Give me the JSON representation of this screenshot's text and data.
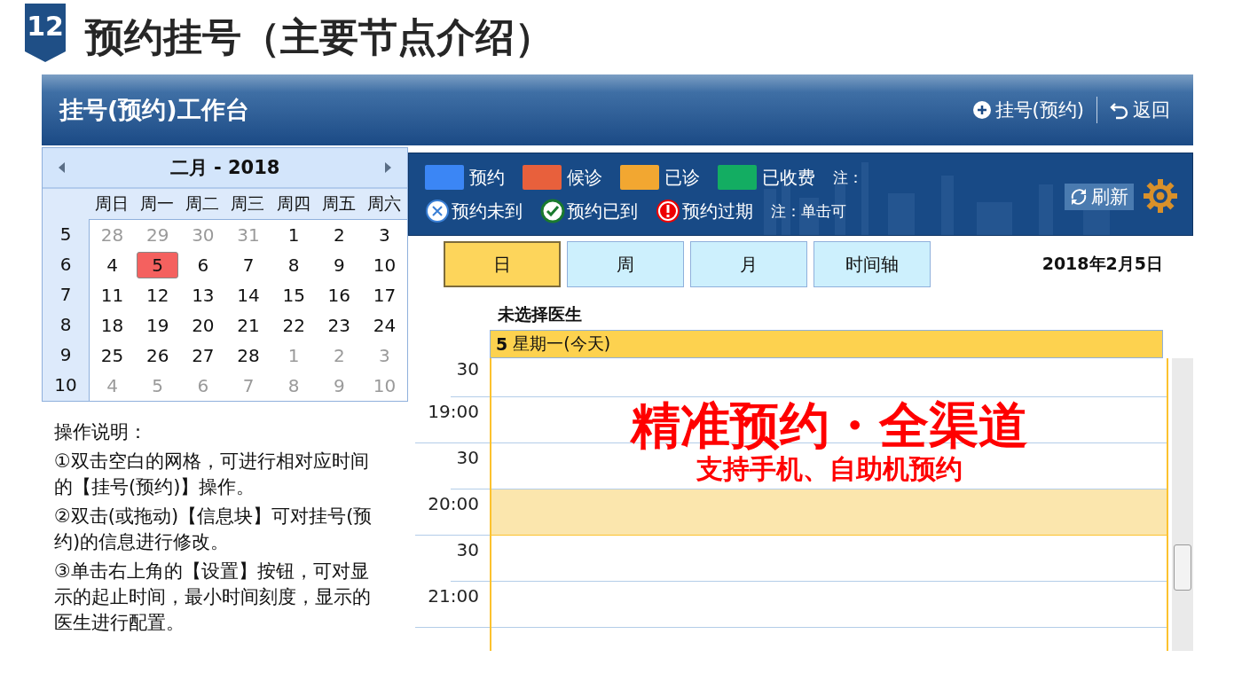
{
  "slide": {
    "number": "12",
    "title": "预约挂号（主要节点介绍）"
  },
  "window": {
    "title": "挂号(预约)工作台",
    "actions": [
      {
        "kind": "add",
        "label": "挂号(预约)"
      },
      {
        "kind": "back",
        "label": "返回"
      }
    ]
  },
  "calendar": {
    "month_title": "二月 - 2018",
    "weekdays": [
      "周日",
      "周一",
      "周二",
      "周三",
      "周四",
      "周五",
      "周六"
    ],
    "weeks": [
      {
        "week": "5",
        "days": [
          {
            "text": "28",
            "other_month": true,
            "selected": false
          },
          {
            "text": "29",
            "other_month": true,
            "selected": false
          },
          {
            "text": "30",
            "other_month": true,
            "selected": false
          },
          {
            "text": "31",
            "other_month": true,
            "selected": false
          },
          {
            "text": "1",
            "other_month": false,
            "selected": false
          },
          {
            "text": "2",
            "other_month": false,
            "selected": false
          },
          {
            "text": "3",
            "other_month": false,
            "selected": false
          }
        ]
      },
      {
        "week": "6",
        "days": [
          {
            "text": "4",
            "other_month": false,
            "selected": false
          },
          {
            "text": "5",
            "other_month": false,
            "selected": true
          },
          {
            "text": "6",
            "other_month": false,
            "selected": false
          },
          {
            "text": "7",
            "other_month": false,
            "selected": false
          },
          {
            "text": "8",
            "other_month": false,
            "selected": false
          },
          {
            "text": "9",
            "other_month": false,
            "selected": false
          },
          {
            "text": "10",
            "other_month": false,
            "selected": false
          }
        ]
      },
      {
        "week": "7",
        "days": [
          {
            "text": "11",
            "other_month": false,
            "selected": false
          },
          {
            "text": "12",
            "other_month": false,
            "selected": false
          },
          {
            "text": "13",
            "other_month": false,
            "selected": false
          },
          {
            "text": "14",
            "other_month": false,
            "selected": false
          },
          {
            "text": "15",
            "other_month": false,
            "selected": false
          },
          {
            "text": "16",
            "other_month": false,
            "selected": false
          },
          {
            "text": "17",
            "other_month": false,
            "selected": false
          }
        ]
      },
      {
        "week": "8",
        "days": [
          {
            "text": "18",
            "other_month": false,
            "selected": false
          },
          {
            "text": "19",
            "other_month": false,
            "selected": false
          },
          {
            "text": "20",
            "other_month": false,
            "selected": false
          },
          {
            "text": "21",
            "other_month": false,
            "selected": false
          },
          {
            "text": "22",
            "other_month": false,
            "selected": false
          },
          {
            "text": "23",
            "other_month": false,
            "selected": false
          },
          {
            "text": "24",
            "other_month": false,
            "selected": false
          }
        ]
      },
      {
        "week": "9",
        "days": [
          {
            "text": "25",
            "other_month": false,
            "selected": false
          },
          {
            "text": "26",
            "other_month": false,
            "selected": false
          },
          {
            "text": "27",
            "other_month": false,
            "selected": false
          },
          {
            "text": "28",
            "other_month": false,
            "selected": false
          },
          {
            "text": "1",
            "other_month": true,
            "selected": false
          },
          {
            "text": "2",
            "other_month": true,
            "selected": false
          },
          {
            "text": "3",
            "other_month": true,
            "selected": false
          }
        ]
      },
      {
        "week": "10",
        "days": [
          {
            "text": "4",
            "other_month": true,
            "selected": false
          },
          {
            "text": "5",
            "other_month": true,
            "selected": false
          },
          {
            "text": "6",
            "other_month": true,
            "selected": false
          },
          {
            "text": "7",
            "other_month": true,
            "selected": false
          },
          {
            "text": "8",
            "other_month": true,
            "selected": false
          },
          {
            "text": "9",
            "other_month": true,
            "selected": false
          },
          {
            "text": "10",
            "other_month": true,
            "selected": false
          }
        ]
      }
    ]
  },
  "instructions": [
    "操作说明：",
    "①双击空白的网格，可进行相对应时间的【挂号(预约)】操作。",
    "②双击(或拖动)【信息块】可对挂号(预约)的信息进行修改。",
    "③单击右上角的【设置】按钮，可对显示的起止时间，最小时间刻度，显示的医生进行配置。"
  ],
  "legend": {
    "statuses": [
      {
        "label": "预约",
        "color": "#3b86f5"
      },
      {
        "label": "候诊",
        "color": "#e8603c"
      },
      {
        "label": "已诊",
        "color": "#f2a731"
      },
      {
        "label": "已收费",
        "color": "#13ad62"
      }
    ],
    "note_1": "注：",
    "marks": [
      {
        "kind": "absent",
        "label": "预约未到"
      },
      {
        "kind": "arrived",
        "label": "预约已到"
      },
      {
        "kind": "expired",
        "label": "预约过期"
      }
    ],
    "note_2": "注：单击可",
    "refresh": "刷新"
  },
  "views": [
    {
      "label": "日",
      "selected": true
    },
    {
      "label": "周",
      "selected": false
    },
    {
      "label": "月",
      "selected": false
    },
    {
      "label": "时间轴",
      "selected": false
    }
  ],
  "date": "2018年2月5日",
  "doctor": "未选择医生",
  "day_header": {
    "day": "5",
    "text": "星期一(今天)"
  },
  "slots": [
    {
      "label": "30",
      "kind": "half",
      "highlighted": false
    },
    {
      "label": "19:00",
      "kind": "hour",
      "highlighted": false
    },
    {
      "label": "30",
      "kind": "half",
      "highlighted": false
    },
    {
      "label": "20:00",
      "kind": "hour",
      "highlighted": true
    },
    {
      "label": "30",
      "kind": "half",
      "highlighted": false
    },
    {
      "label": "21:00",
      "kind": "hour",
      "highlighted": false
    }
  ],
  "overlay": {
    "headline": "精准预约・全渠道",
    "subline": "支持手机、自助机预约"
  }
}
